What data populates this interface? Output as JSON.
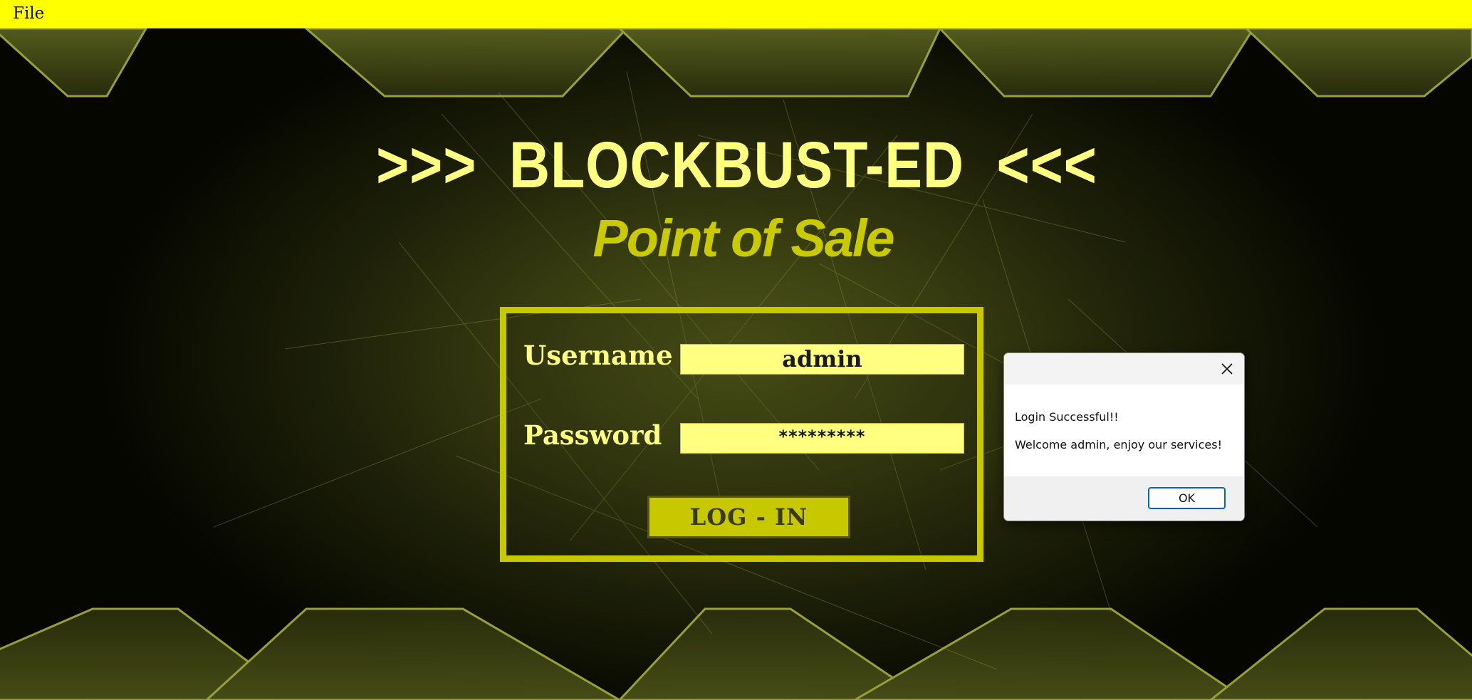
{
  "menubar": {
    "file_label": "File"
  },
  "header": {
    "title": ">>>  BLOCKBUST-ED  <<<",
    "subtitle": "Point of Sale"
  },
  "login": {
    "username_label": "Username",
    "username_value": "admin",
    "password_label": "Password",
    "password_value": "*********",
    "login_button": "LOG - IN"
  },
  "dialog": {
    "line1": "Login Successful!!",
    "line2": "Welcome admin, enjoy our services!",
    "ok_label": "OK"
  },
  "colors": {
    "menubar": "#ffff00",
    "accent_yellow": "#c8c800",
    "title_yellow": "#ffff80",
    "dialog_focus_blue": "#0067c0"
  },
  "icons": {
    "dialog_close": "close-icon"
  }
}
